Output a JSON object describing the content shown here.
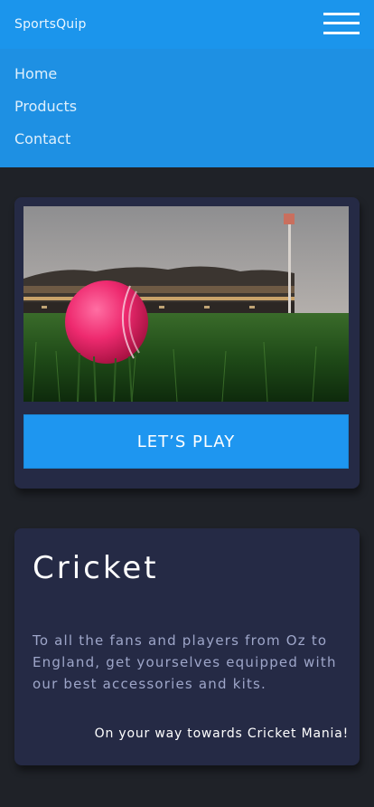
{
  "header": {
    "brand": "SportsQuip",
    "menu_icon": "hamburger-menu-icon"
  },
  "nav": {
    "items": [
      {
        "label": "Home"
      },
      {
        "label": "Products"
      },
      {
        "label": "Contact"
      }
    ]
  },
  "hero_card": {
    "image_alt": "cricket-ball-on-field",
    "button_label": "LET’S PLAY"
  },
  "info_card": {
    "title": "Cricket",
    "description": "To all the fans and players from Oz to England, get yourselves equipped with our best accessories and kits.",
    "tagline": "On your way towards Cricket Mania!"
  },
  "colors": {
    "header_bg": "#1b95ec",
    "nav_bg": "#1e90e3",
    "page_bg": "#1f2228",
    "card_bg": "#252a45",
    "accent": "#1e96f0"
  }
}
